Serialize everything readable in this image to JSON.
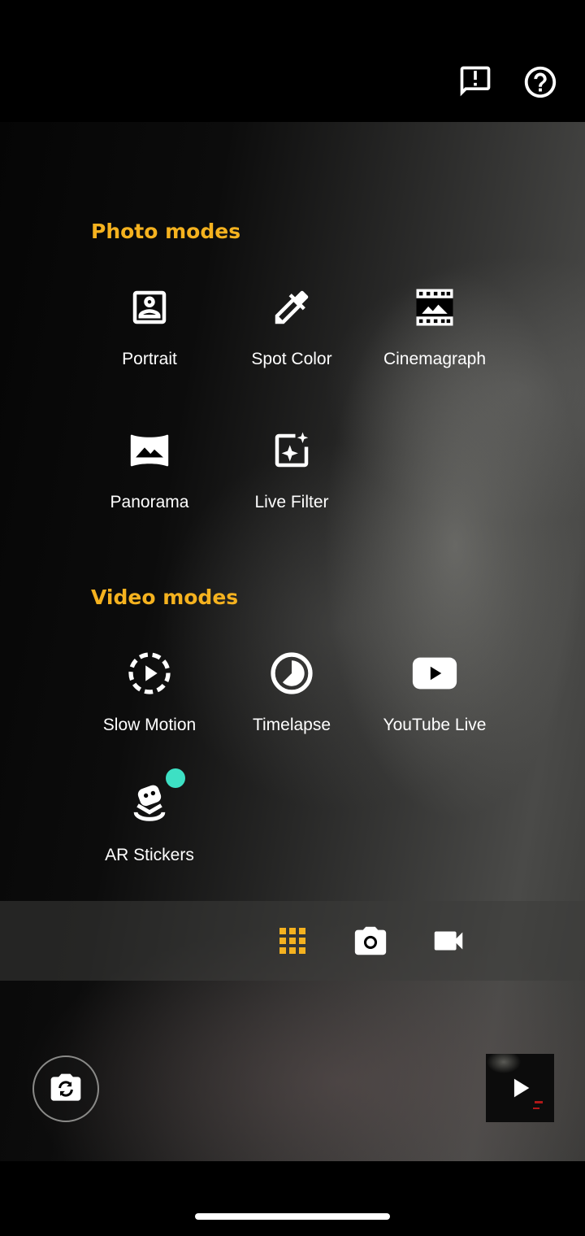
{
  "header": {
    "feedback_icon": "feedback-icon",
    "help_icon": "help-icon"
  },
  "photo_modes": {
    "title": "Photo modes",
    "items": [
      {
        "label": "Portrait",
        "icon": "portrait-icon"
      },
      {
        "label": "Spot Color",
        "icon": "eyedropper-icon"
      },
      {
        "label": "Cinemagraph",
        "icon": "film-icon"
      },
      {
        "label": "Panorama",
        "icon": "panorama-icon"
      },
      {
        "label": "Live Filter",
        "icon": "sparkle-filter-icon"
      }
    ]
  },
  "video_modes": {
    "title": "Video modes",
    "items": [
      {
        "label": "Slow Motion",
        "icon": "slow-motion-icon"
      },
      {
        "label": "Timelapse",
        "icon": "timelapse-icon"
      },
      {
        "label": "YouTube Live",
        "icon": "youtube-icon"
      },
      {
        "label": "AR Stickers",
        "icon": "ar-stickers-icon",
        "new_badge": true
      }
    ]
  },
  "mode_bar": {
    "items": [
      {
        "icon": "grid-icon",
        "selected": true
      },
      {
        "icon": "camera-icon",
        "selected": false
      },
      {
        "icon": "video-camera-icon",
        "selected": false
      }
    ]
  },
  "controls": {
    "switch_camera_icon": "switch-camera-icon",
    "gallery_play_icon": "play-icon"
  },
  "colors": {
    "accent": "#f5b21f",
    "badge": "#3de0c4",
    "icon": "#ffffff"
  }
}
